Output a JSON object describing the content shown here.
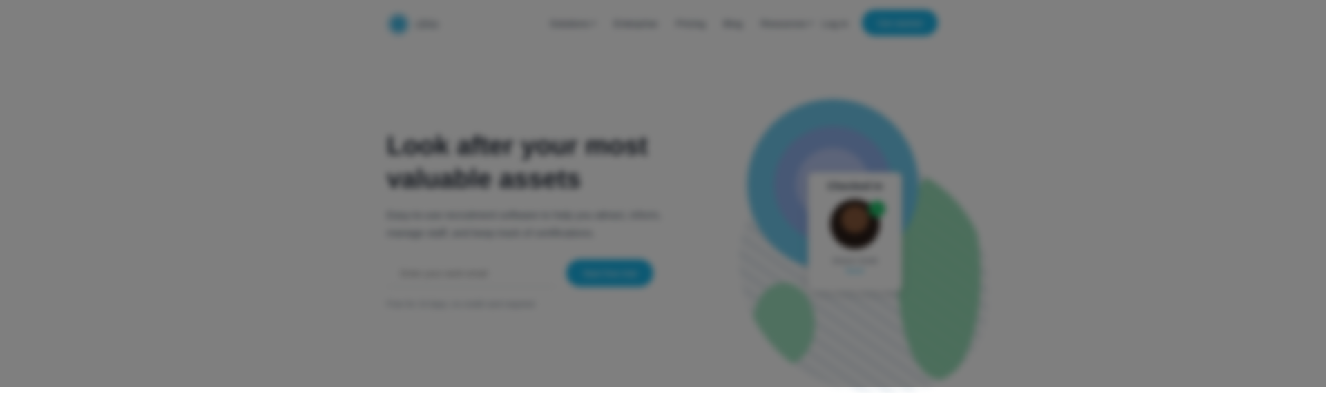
{
  "header": {
    "logo_text": "clrio",
    "nav": [
      {
        "label": "Solutions",
        "has_dropdown": true
      },
      {
        "label": "Enterprise",
        "has_dropdown": false
      },
      {
        "label": "Pricing",
        "has_dropdown": false
      },
      {
        "label": "Blog",
        "has_dropdown": false
      },
      {
        "label": "Resources",
        "has_dropdown": true
      }
    ],
    "login_label": "Log in",
    "cta_label": "Get started"
  },
  "hero": {
    "title": "Look after your most valuable assets",
    "subtitle": "Easy-to-use recruitment software to help you attract, inform, manage staff, and keep track of certifications.",
    "email_placeholder": "Enter your work email",
    "button_label": "Start free trial",
    "note": "Free for 14 days, no credit card required"
  },
  "illustration": {
    "card_title": "Checked in",
    "card_name": "Sharon Smith",
    "card_role": "Nurse"
  },
  "colors": {
    "accent": "#19b2e6",
    "status_green": "#22c06a",
    "overlay": "rgba(0,0,0,0.5)"
  }
}
